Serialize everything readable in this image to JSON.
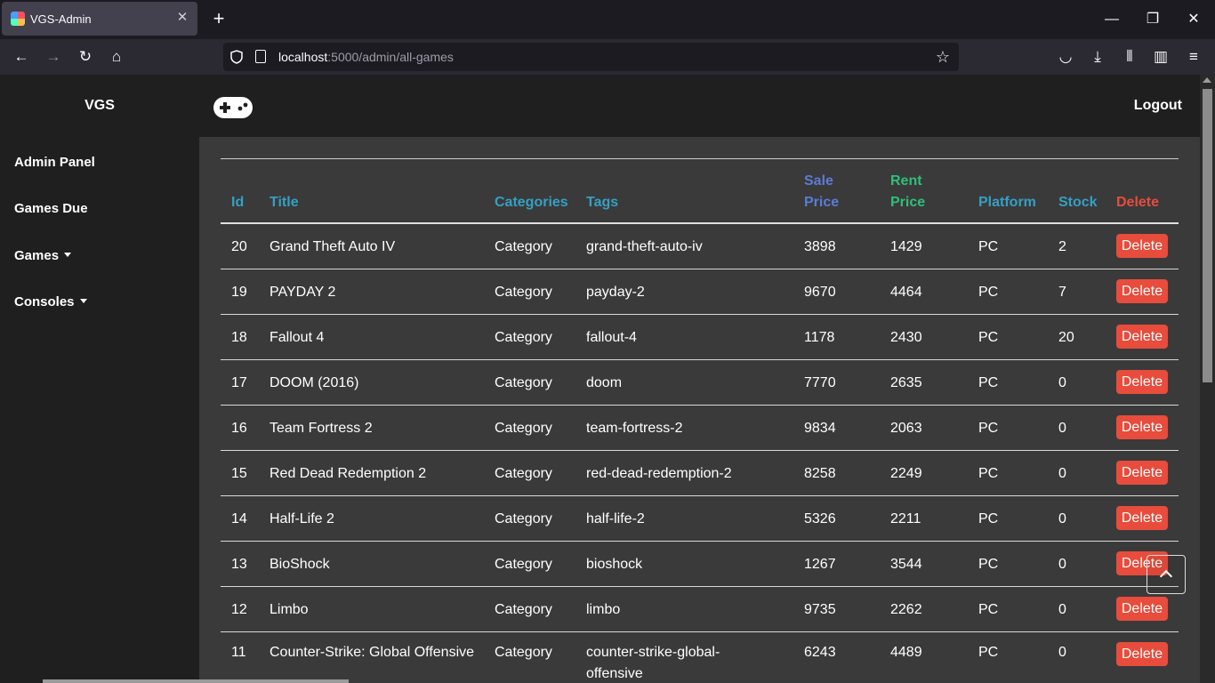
{
  "browser": {
    "tab_title": "VGS-Admin",
    "url_host": "localhost",
    "url_rest": ":5000/admin/all-games"
  },
  "sidebar": {
    "brand": "VGS",
    "items": [
      {
        "label": "Admin Panel"
      },
      {
        "label": "Games Due"
      },
      {
        "label": "Games"
      },
      {
        "label": "Consoles"
      }
    ]
  },
  "header": {
    "logout_label": "Logout"
  },
  "table": {
    "headers": {
      "id": "Id",
      "title": "Title",
      "categories": "Categories",
      "tags": "Tags",
      "sale_price_1": "Sale",
      "sale_price_2": "Price",
      "rent_price_1": "Rent",
      "rent_price_2": "Price",
      "platform": "Platform",
      "stock": "Stock",
      "delete": "Delete"
    },
    "header_colors": {
      "default": "#34a0c4",
      "sale": "#5b7bd6",
      "rent": "#2fbf7a",
      "delete": "#e74c3c"
    },
    "delete_label": "Delete",
    "rows": [
      {
        "id": "20",
        "title": "Grand Theft Auto IV",
        "category": "Category",
        "tags": "grand-theft-auto-iv",
        "sale": "3898",
        "rent": "1429",
        "platform": "PC",
        "stock": "2"
      },
      {
        "id": "19",
        "title": "PAYDAY 2",
        "category": "Category",
        "tags": "payday-2",
        "sale": "9670",
        "rent": "4464",
        "platform": "PC",
        "stock": "7"
      },
      {
        "id": "18",
        "title": "Fallout 4",
        "category": "Category",
        "tags": "fallout-4",
        "sale": "1178",
        "rent": "2430",
        "platform": "PC",
        "stock": "20"
      },
      {
        "id": "17",
        "title": "DOOM (2016)",
        "category": "Category",
        "tags": "doom",
        "sale": "7770",
        "rent": "2635",
        "platform": "PC",
        "stock": "0"
      },
      {
        "id": "16",
        "title": "Team Fortress 2",
        "category": "Category",
        "tags": "team-fortress-2",
        "sale": "9834",
        "rent": "2063",
        "platform": "PC",
        "stock": "0"
      },
      {
        "id": "15",
        "title": "Red Dead Redemption 2",
        "category": "Category",
        "tags": "red-dead-redemption-2",
        "sale": "8258",
        "rent": "2249",
        "platform": "PC",
        "stock": "0"
      },
      {
        "id": "14",
        "title": "Half-Life 2",
        "category": "Category",
        "tags": "half-life-2",
        "sale": "5326",
        "rent": "2211",
        "platform": "PC",
        "stock": "0"
      },
      {
        "id": "13",
        "title": "BioShock",
        "category": "Category",
        "tags": "bioshock",
        "sale": "1267",
        "rent": "3544",
        "platform": "PC",
        "stock": "0"
      },
      {
        "id": "12",
        "title": "Limbo",
        "category": "Category",
        "tags": "limbo",
        "sale": "9735",
        "rent": "2262",
        "platform": "PC",
        "stock": "0"
      },
      {
        "id": "11",
        "title": "Counter-Strike: Global Offensive",
        "category": "Category",
        "tags": "counter-strike-global-offensive",
        "sale": "6243",
        "rent": "4489",
        "platform": "PC",
        "stock": "0"
      }
    ]
  }
}
